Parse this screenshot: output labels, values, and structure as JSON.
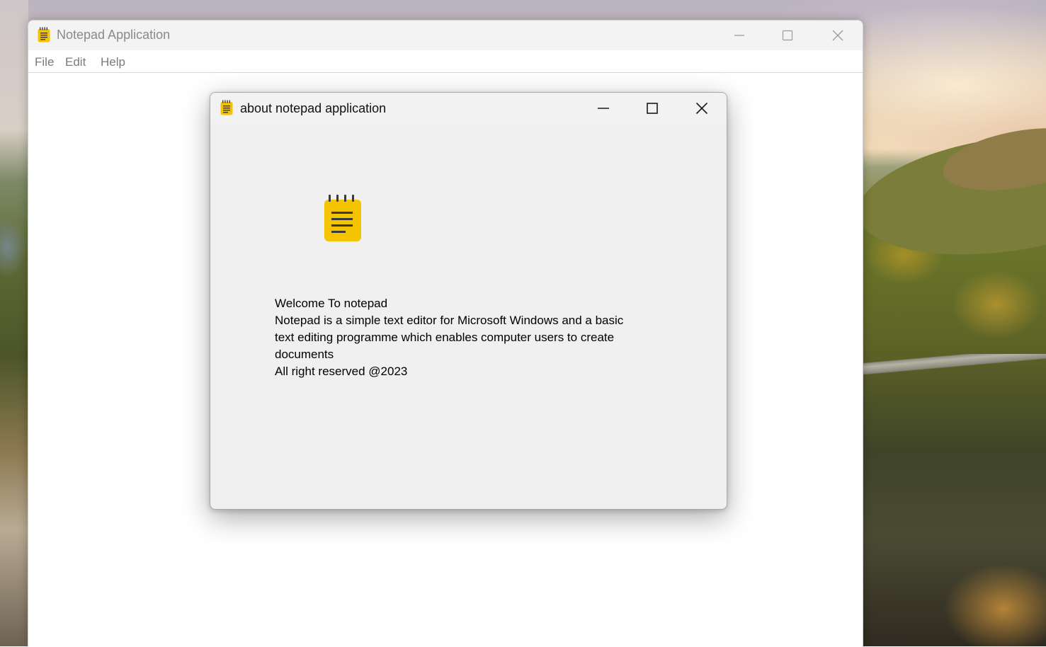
{
  "main_window": {
    "title": "Notepad Application",
    "icon": "notepad-icon",
    "caption_buttons": [
      "minimize-icon",
      "maximize-icon",
      "close-icon"
    ],
    "menu": [
      {
        "label": "File"
      },
      {
        "label": "Edit"
      },
      {
        "label": "Help"
      }
    ]
  },
  "about_dialog": {
    "title": "about notepad application",
    "icon": "notepad-icon",
    "caption_buttons": [
      "minimize-icon",
      "maximize-icon",
      "close-icon"
    ],
    "lines": [
      "Welcome To notepad",
      "Notepad is a simple text editor for Microsoft Windows and a basic",
      "text editing programme which enables computer users to create",
      "documents",
      "All right reserved @2023"
    ]
  },
  "colors": {
    "icon_yellow": "#f5c400",
    "icon_lines": "#3a3a3a",
    "dialog_bg": "#f0f0f0"
  }
}
